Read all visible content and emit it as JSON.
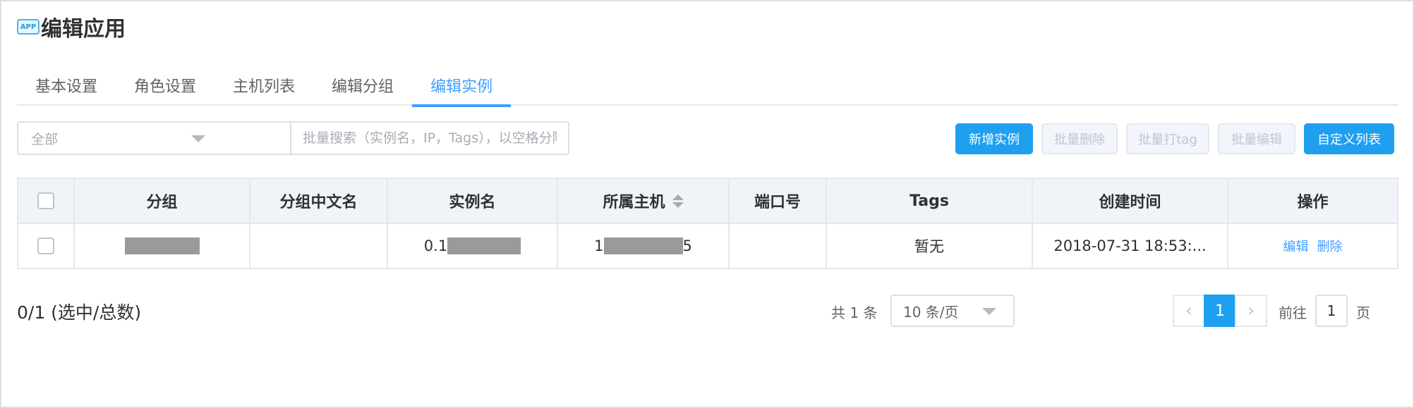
{
  "header": {
    "icon": "app-icon",
    "badge_text": "APP",
    "title": "编辑应用"
  },
  "tabs": [
    {
      "label": "基本设置",
      "active": false
    },
    {
      "label": "角色设置",
      "active": false
    },
    {
      "label": "主机列表",
      "active": false
    },
    {
      "label": "编辑分组",
      "active": false
    },
    {
      "label": "编辑实例",
      "active": true
    }
  ],
  "filter": {
    "group_select_value": "全部",
    "search_placeholder": "批量搜索（实例名，IP，Tags），以空格分隔"
  },
  "toolbar": {
    "add_instance": "新增实例",
    "batch_delete": "批量删除",
    "batch_tag": "批量打tag",
    "batch_edit": "批量编辑",
    "custom_columns": "自定义列表"
  },
  "table": {
    "columns": [
      "分组",
      "分组中文名",
      "实例名",
      "所属主机",
      "端口号",
      "Tags",
      "创建时间",
      "操作"
    ],
    "rows": [
      {
        "group": "",
        "group_cn": "",
        "instance_prefix": "0.1",
        "host_prefix": "1",
        "host_suffix": "5",
        "port": "",
        "tags": "暂无",
        "created_at": "2018-07-31 18:53:...",
        "edit": "编辑",
        "delete": "删除"
      }
    ]
  },
  "footer": {
    "selection_count": "0/1 (选中/总数)",
    "total": "共 1 条",
    "page_size": "10 条/页",
    "current_page": "1",
    "goto_prefix": "前往",
    "goto_value": "1",
    "goto_suffix": "页"
  },
  "colors": {
    "primary": "#1f9ff0",
    "link": "#409eff",
    "header_bg": "#f0f3f8"
  }
}
